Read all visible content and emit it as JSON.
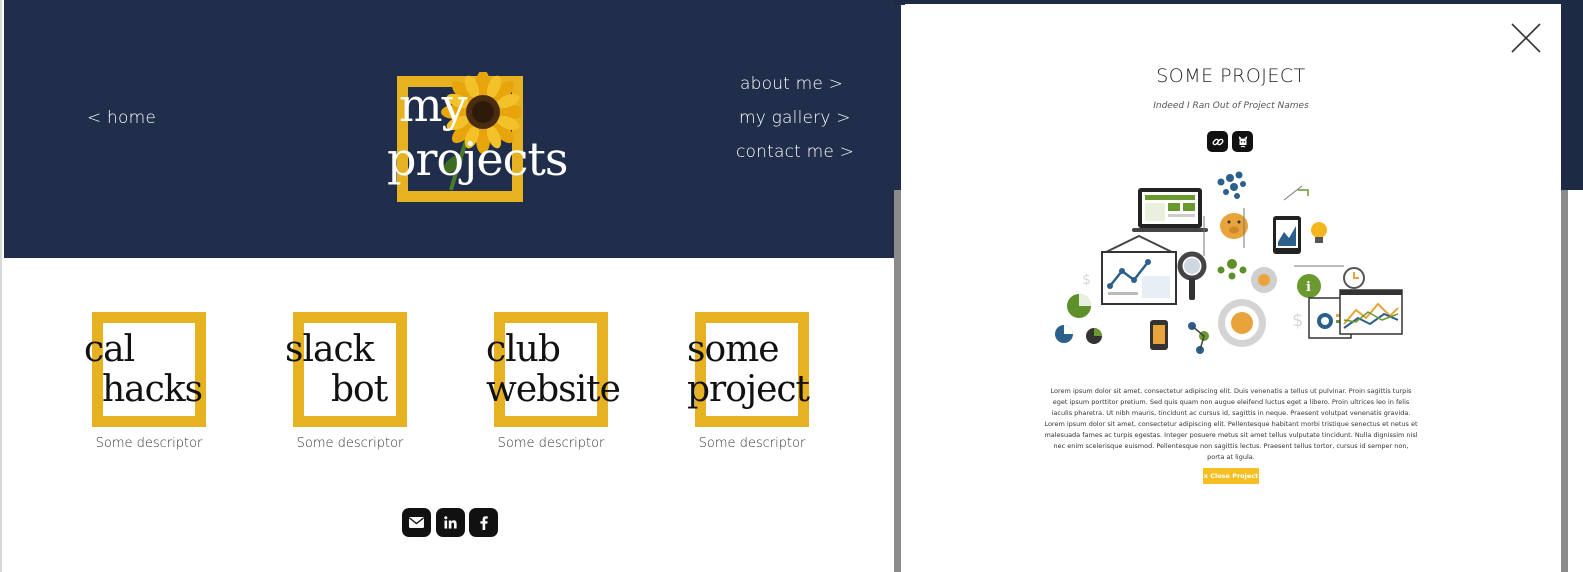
{
  "nav": {
    "home": "< home",
    "about": "about me >",
    "gallery": "my gallery >",
    "contact": "contact me >"
  },
  "logo": {
    "line1": "my",
    "line2": "projects"
  },
  "projects": [
    {
      "line1": "cal",
      "line2": "hacks",
      "descriptor": "Some descriptor"
    },
    {
      "line1": "slack",
      "line2": "bot",
      "descriptor": "Some descriptor"
    },
    {
      "line1": "club",
      "line2": "website",
      "descriptor": "Some descriptor"
    },
    {
      "line1": "some",
      "line2": "project",
      "descriptor": "Some descriptor"
    }
  ],
  "social": [
    "envelope-icon",
    "linkedin-icon",
    "facebook-icon"
  ],
  "modal": {
    "title": "SOME PROJECT",
    "subtitle": "Indeed I Ran Out of Project Names",
    "body": "Lorem ipsum dolor sit amet, consectetur adipiscing elit. Duis venenatis a tellus ut pulvinar. Proin sagittis turpis eget ipsum porttitor pretium. Sed quis quam non augue eleifend luctus eget a libero. Proin ultrices leo in felis iaculis pharetra. Ut nibh mauris, tincidunt ac cursus id, sagittis in neque. Praesent volutpat venenatis gravida. Lorem ipsum dolor sit amet, consectetur adipiscing elit. Pellentesque habitant morbi tristique senectus et netus et malesuada fames ac turpis egestas. Integer posuere metus sit amet tellus vulputate tincidunt. Nulla dignissim nisl nec enim scelerisque euismod. Pellentesque non sagittis lectus. Praesent tellus tortor, cursus id semper non, porta at ligula.",
    "close_button": "x Close Project",
    "icons": [
      "link-icon",
      "github-icon"
    ]
  },
  "colors": {
    "navy": "#212e4b",
    "accent_yellow": "#e7b221",
    "button_yellow": "#f3bf22"
  }
}
